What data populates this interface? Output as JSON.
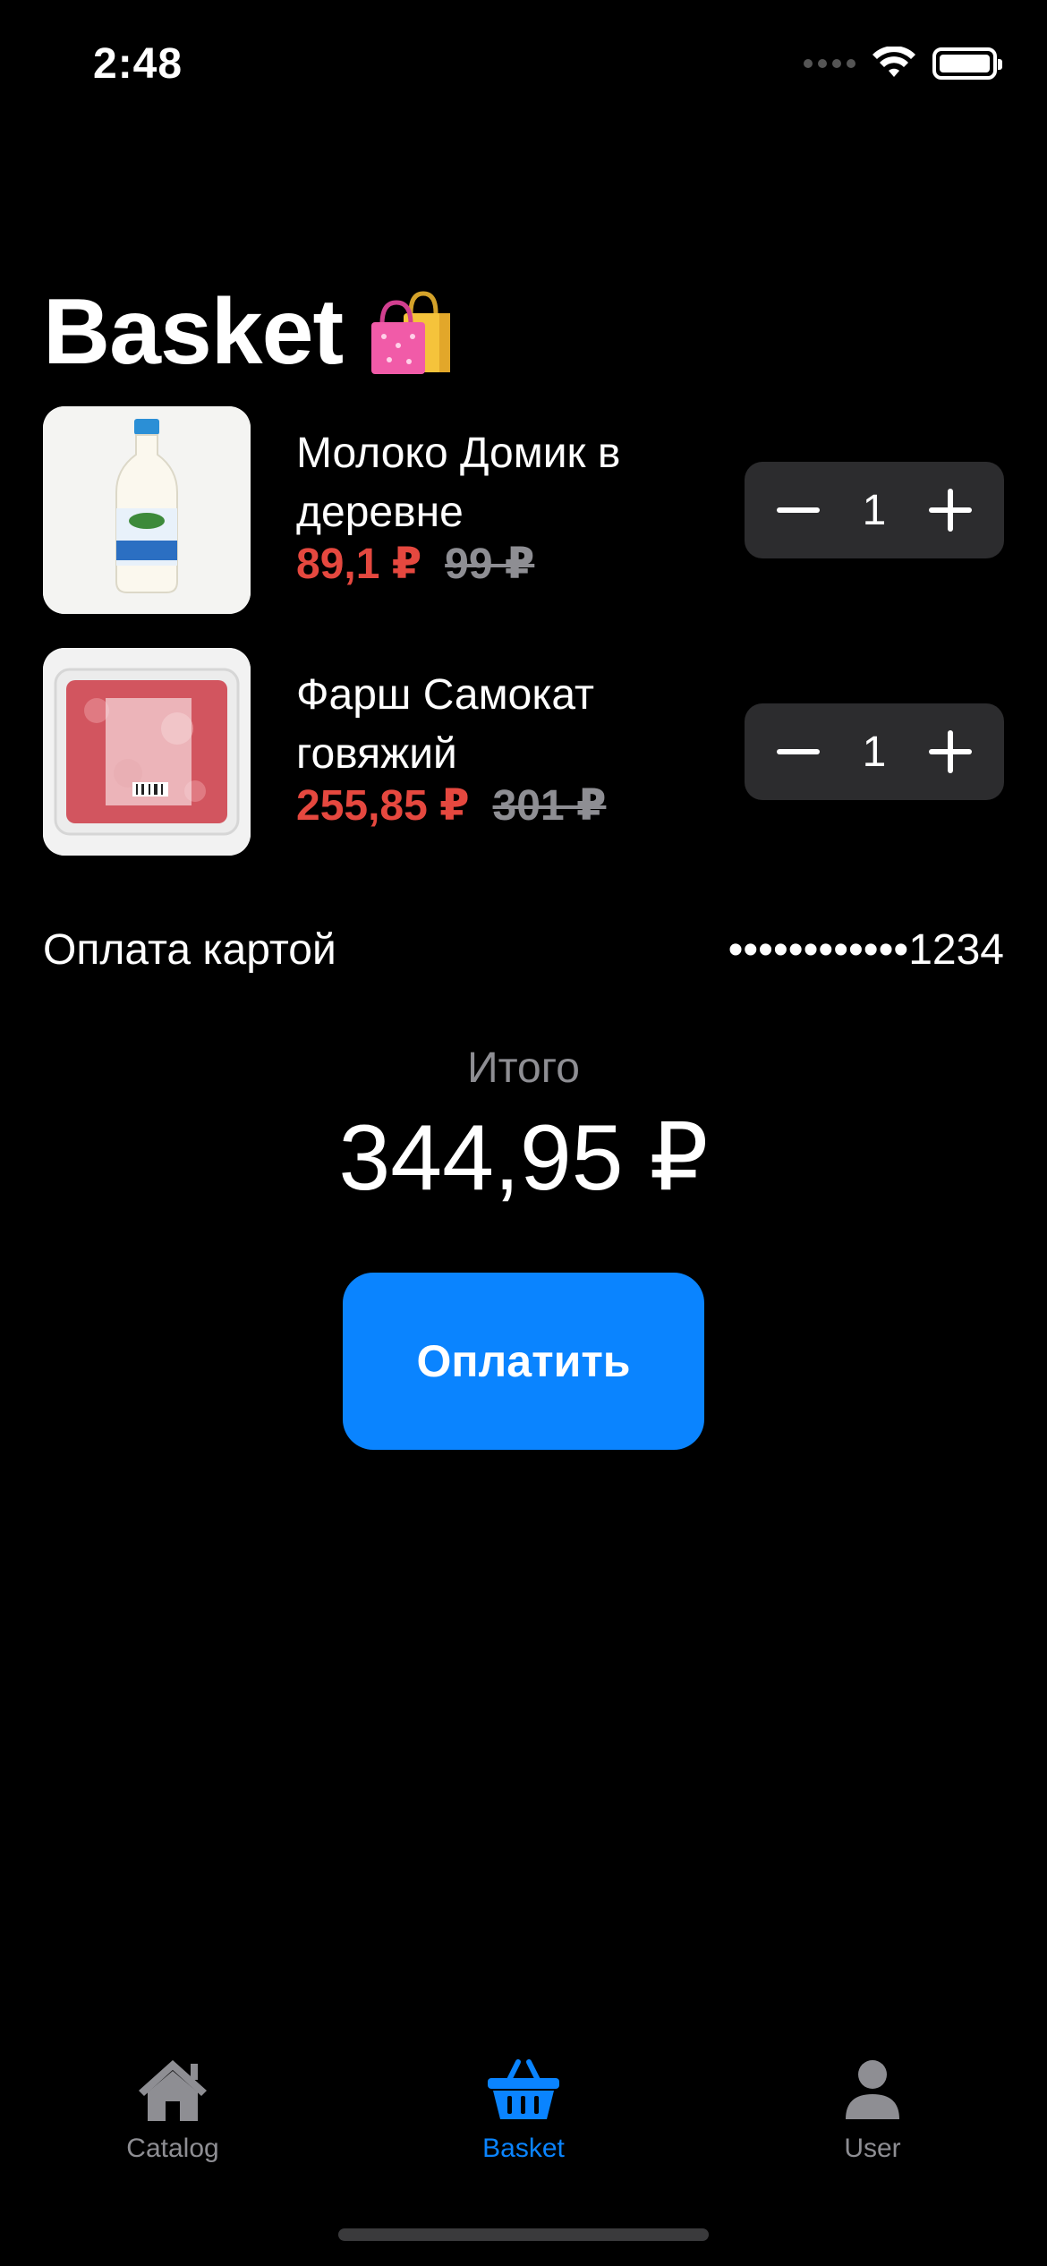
{
  "status_bar": {
    "time": "2:48"
  },
  "header": {
    "title": "Basket",
    "title_icon": "shopping-bags-icon"
  },
  "items": [
    {
      "name": "Молоко Домик в деревне",
      "price": "89,1 ₽",
      "old_price": "99 ₽",
      "quantity": "1",
      "image": "milk-bottle"
    },
    {
      "name": "Фарш Самокат говяжий",
      "price": "255,85 ₽",
      "old_price": "301 ₽",
      "quantity": "1",
      "image": "minced-meat-pack"
    }
  ],
  "payment": {
    "label": "Оплата картой",
    "card": "••••••••••••1234"
  },
  "total": {
    "label": "Итого",
    "value": "344,95 ₽"
  },
  "pay_button": {
    "label": "Оплатить"
  },
  "tab_bar": {
    "tabs": [
      {
        "label": "Catalog",
        "icon": "house-icon",
        "active": false
      },
      {
        "label": "Basket",
        "icon": "basket-icon",
        "active": true
      },
      {
        "label": "User",
        "icon": "person-icon",
        "active": false
      }
    ]
  },
  "colors": {
    "accent": "#0a84ff",
    "sale_price": "#e5483f",
    "muted": "#8e8e93",
    "stepper_bg": "#2c2c2e"
  }
}
